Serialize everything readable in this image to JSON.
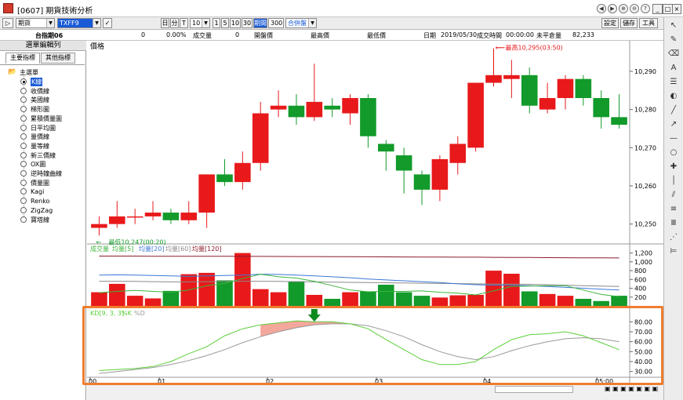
{
  "window": {
    "title": "[0607] 期貨技術分析",
    "title_buttons": [
      "◀",
      "▶",
      "⊕",
      "⊖",
      "?"
    ]
  },
  "toolbar": {
    "market": "期貨",
    "symbol": "TXFF9",
    "period_buttons": [
      "日",
      "分",
      "T"
    ],
    "period_value": "10",
    "minute_buttons": [
      "1",
      "5",
      "10",
      "30"
    ],
    "interval_label": "期間",
    "interval_value": "300",
    "combine_mode": "合併盤",
    "right_buttons": [
      "設定",
      "儲存",
      "工具"
    ]
  },
  "infobar": {
    "name": "台指期06",
    "field_1": "0",
    "field_2": "0.00%",
    "volume_label": "成交量",
    "volume_value": "0",
    "open_label": "開盤價",
    "high_label": "最高價",
    "low_label": "最低價",
    "date_label": "日期",
    "date_value": "2019/05/30",
    "time_label": "成交時間",
    "time_value": "00:00:00",
    "oi_label": "未平倉量",
    "oi_value": "82,233"
  },
  "sidebar": {
    "header": "選單編輯列",
    "tabs": [
      "主要指標",
      "其他指標"
    ],
    "root": "主選單",
    "items": [
      "K線",
      "收價線",
      "美國線",
      "梯形圖",
      "累積價量圖",
      "日平均圖",
      "量價線",
      "量等線",
      "新三價線",
      "OX圖",
      "逆時鐘曲線",
      "價量圖",
      "Kagi",
      "Renko",
      "ZigZag",
      "寶塔線"
    ],
    "selected_index": 0
  },
  "colors": {
    "up": "#e8191b",
    "down": "#129a2a",
    "ma5": "#3cb43c",
    "ma20": "#3b78d8",
    "ma60": "#8b8b8b",
    "ma120": "#8b1c2c",
    "k_line": "#5ccf3a",
    "d_line": "#999999",
    "highlight": "#ef7d2f"
  },
  "chart_data": [
    {
      "type": "candlestick",
      "title": "價格",
      "x_tick_labels": [
        "00",
        "01",
        "02",
        "03",
        "04",
        "05:00"
      ],
      "ylim": [
        10245,
        10298
      ],
      "y_ticks": [
        10250,
        10260,
        10270,
        10280,
        10290
      ],
      "y_tick_labels": [
        "10,250",
        "10,260",
        "10,270",
        "10,280",
        "10,290"
      ],
      "annotations": {
        "high": "最高10,295(03:50)",
        "low": "最低10,247(00:20)"
      },
      "candles": [
        {
          "o": 10249,
          "c": 10250,
          "h": 10252,
          "l": 10247
        },
        {
          "o": 10250,
          "c": 10252,
          "h": 10256,
          "l": 10249
        },
        {
          "o": 10252,
          "c": 10252,
          "h": 10254,
          "l": 10250
        },
        {
          "o": 10252,
          "c": 10253,
          "h": 10256,
          "l": 10251
        },
        {
          "o": 10253,
          "c": 10251,
          "h": 10254,
          "l": 10250
        },
        {
          "o": 10251,
          "c": 10253,
          "h": 10256,
          "l": 10250
        },
        {
          "o": 10253,
          "c": 10263,
          "h": 10263,
          "l": 10249
        },
        {
          "o": 10263,
          "c": 10261,
          "h": 10267,
          "l": 10260
        },
        {
          "o": 10261,
          "c": 10266,
          "h": 10269,
          "l": 10259
        },
        {
          "o": 10266,
          "c": 10279,
          "h": 10282,
          "l": 10264
        },
        {
          "o": 10280,
          "c": 10281,
          "h": 10285,
          "l": 10278
        },
        {
          "o": 10281,
          "c": 10278,
          "h": 10284,
          "l": 10276
        },
        {
          "o": 10278,
          "c": 10282,
          "h": 10292,
          "l": 10277
        },
        {
          "o": 10281,
          "c": 10280,
          "h": 10283,
          "l": 10278
        },
        {
          "o": 10279,
          "c": 10283,
          "h": 10284,
          "l": 10276
        },
        {
          "o": 10283,
          "c": 10273,
          "h": 10284,
          "l": 10270
        },
        {
          "o": 10271,
          "c": 10269,
          "h": 10272,
          "l": 10264
        },
        {
          "o": 10268,
          "c": 10264,
          "h": 10270,
          "l": 10258
        },
        {
          "o": 10263,
          "c": 10259,
          "h": 10264,
          "l": 10255
        },
        {
          "o": 10259,
          "c": 10267,
          "h": 10268,
          "l": 10256
        },
        {
          "o": 10266,
          "c": 10271,
          "h": 10273,
          "l": 10263
        },
        {
          "o": 10270,
          "c": 10287,
          "h": 10287,
          "l": 10269
        },
        {
          "o": 10287,
          "c": 10289,
          "h": 10296,
          "l": 10286
        },
        {
          "o": 10288,
          "c": 10289,
          "h": 10293,
          "l": 10283
        },
        {
          "o": 10289,
          "c": 10281,
          "h": 10291,
          "l": 10279
        },
        {
          "o": 10280,
          "c": 10283,
          "h": 10287,
          "l": 10279
        },
        {
          "o": 10283,
          "c": 10288,
          "h": 10289,
          "l": 10280
        },
        {
          "o": 10288,
          "c": 10283,
          "h": 10289,
          "l": 10281
        },
        {
          "o": 10283,
          "c": 10278,
          "h": 10285,
          "l": 10275
        },
        {
          "o": 10278,
          "c": 10276,
          "h": 10284,
          "l": 10275
        }
      ]
    },
    {
      "type": "bar",
      "title": "成交量",
      "legend": [
        "均量[5]",
        "均量[20]",
        "均量[60]",
        "均量[120]"
      ],
      "ylim": [
        0,
        1300
      ],
      "y_ticks": [
        200,
        400,
        600,
        800,
        1000,
        1200
      ],
      "y_tick_labels": [
        "200",
        "400",
        "600",
        "800",
        "1,000",
        "1,200"
      ],
      "values": [
        310,
        500,
        230,
        170,
        340,
        720,
        750,
        580,
        1200,
        380,
        310,
        560,
        250,
        160,
        310,
        330,
        480,
        310,
        230,
        190,
        240,
        250,
        800,
        730,
        330,
        270,
        230,
        160,
        110,
        230
      ],
      "ma5": [
        300,
        330,
        350,
        330,
        310,
        360,
        460,
        510,
        620,
        720,
        660,
        630,
        560,
        460,
        360,
        320,
        330,
        330,
        340,
        310,
        290,
        250,
        340,
        440,
        450,
        460,
        460,
        360,
        260,
        210
      ],
      "ma20": [
        700,
        705,
        700,
        690,
        680,
        670,
        680,
        690,
        700,
        720,
        715,
        700,
        680,
        660,
        640,
        610,
        590,
        570,
        550,
        530,
        500,
        480,
        470,
        470,
        460,
        440,
        420,
        400,
        380,
        360
      ],
      "ma60": [
        560,
        560,
        555,
        550,
        545,
        545,
        550,
        555,
        560,
        560,
        555,
        550,
        545,
        540,
        535,
        530,
        525,
        520,
        515,
        510,
        505,
        500,
        495,
        495,
        490,
        480,
        470,
        460,
        450,
        440
      ],
      "ma120": [
        1130,
        1130,
        1130,
        1128,
        1128,
        1126,
        1125,
        1125,
        1124,
        1123,
        1122,
        1121,
        1120,
        1118,
        1116,
        1115,
        1113,
        1112,
        1110,
        1108,
        1106,
        1105,
        1103,
        1100,
        1098,
        1096,
        1094,
        1092,
        1090,
        1088
      ]
    },
    {
      "type": "line",
      "title": "KD[9, 3, 3]",
      "legend": [
        "%K",
        "%D"
      ],
      "ylim": [
        25,
        85
      ],
      "y_ticks": [
        30,
        40,
        50,
        60,
        70,
        80
      ],
      "y_tick_labels": [
        "30.00",
        "40.00",
        "50.00",
        "60.00",
        "70.00",
        "80.00"
      ],
      "k": [
        31,
        32,
        33,
        35,
        40,
        48,
        55,
        66,
        73,
        77,
        79,
        81,
        80,
        80,
        78,
        73,
        62,
        52,
        42,
        37,
        37,
        40,
        52,
        62,
        67,
        68,
        70,
        66,
        59,
        52
      ],
      "d": [
        28,
        30,
        32,
        34,
        37,
        41,
        46,
        52,
        59,
        65,
        70,
        74,
        77,
        78,
        78,
        76,
        71,
        65,
        57,
        50,
        45,
        42,
        45,
        51,
        56,
        60,
        63,
        64,
        63,
        60
      ]
    }
  ]
}
